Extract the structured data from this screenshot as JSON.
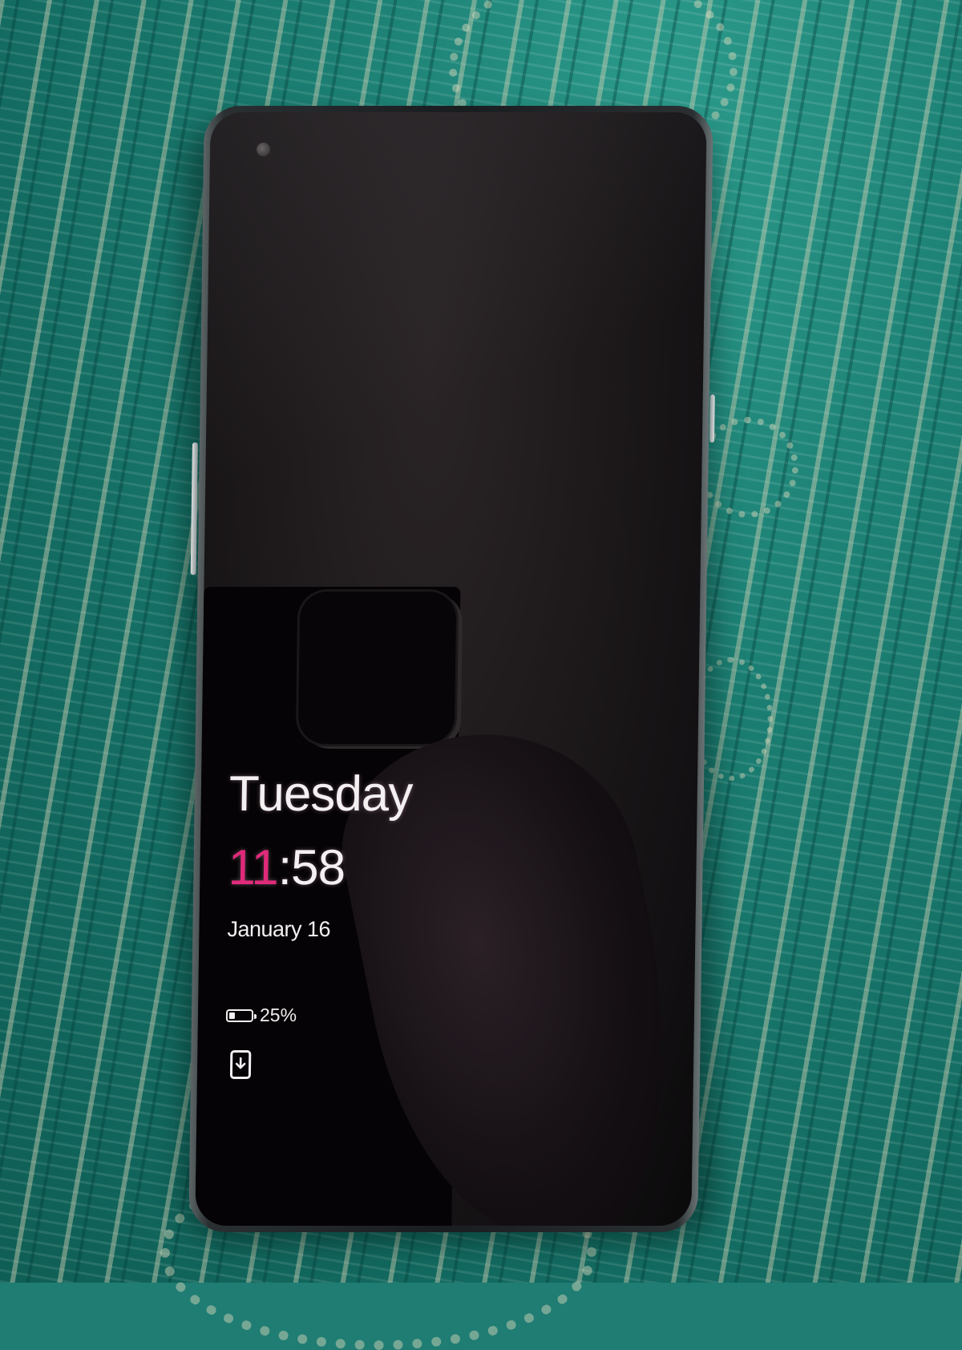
{
  "lock_screen": {
    "day": "Tuesday",
    "time": {
      "hours": "11",
      "separator": ":",
      "minutes": "58"
    },
    "date": "January 16",
    "battery": {
      "percent_label": "25%",
      "level": 0.25
    },
    "notification_icon": "download-notification-icon"
  },
  "colors": {
    "accent": "#e02a7a",
    "text": "#f4f0f2",
    "screen": "#151214",
    "fabric": "#1f7d73"
  }
}
